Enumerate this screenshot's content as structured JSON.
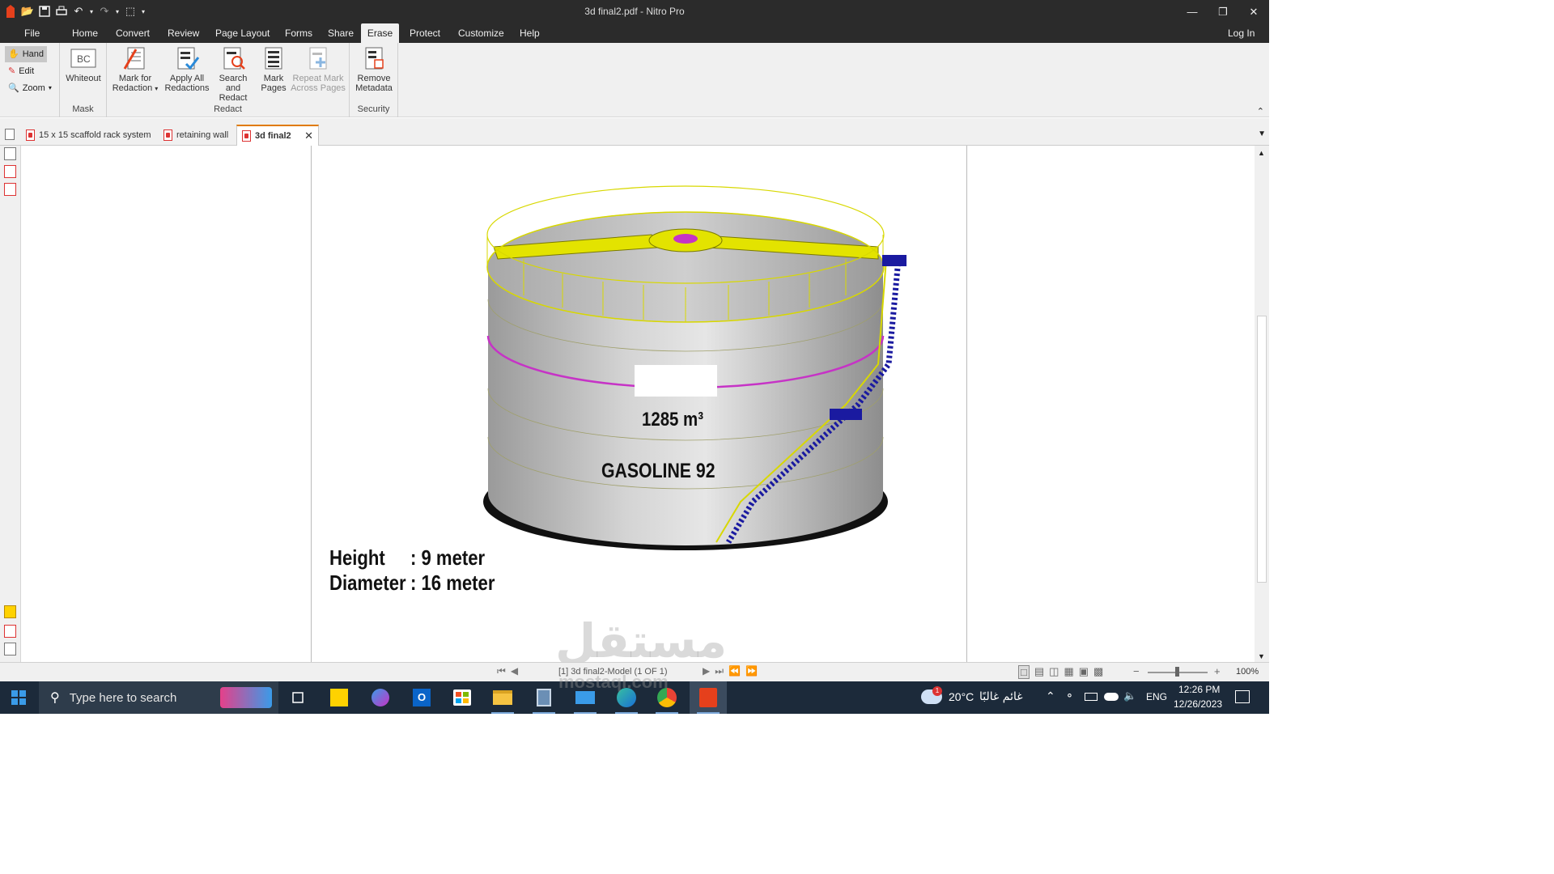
{
  "window": {
    "title": "3d final2.pdf - Nitro Pro",
    "login": "Log In"
  },
  "menu": [
    "File",
    "Home",
    "Convert",
    "Review",
    "Page Layout",
    "Forms",
    "Share",
    "Erase",
    "Protect",
    "Customize",
    "Help"
  ],
  "active_menu": "Erase",
  "ribbon": {
    "tools": {
      "hand": "Hand",
      "edit": "Edit",
      "zoom": "Zoom"
    },
    "mask": {
      "label": "Mask",
      "whiteout": "Whiteout"
    },
    "redact": {
      "label": "Redact",
      "mark1": "Mark for",
      "mark2": "Redaction",
      "apply1": "Apply All",
      "apply2": "Redactions",
      "search1": "Search and",
      "search2": "Redact",
      "pages1": "Mark",
      "pages2": "Pages",
      "repeat1": "Repeat Mark",
      "repeat2": "Across Pages"
    },
    "security": {
      "label": "Security",
      "remove1": "Remove",
      "remove2": "Metadata"
    }
  },
  "doc_tabs": [
    {
      "label": "15 x 15 scaffold rack system"
    },
    {
      "label": "retaining wall"
    },
    {
      "label": "3d final2"
    }
  ],
  "document": {
    "capacity": "1285 m³",
    "product": "GASOLINE 92",
    "height_label": "Height",
    "height_value": ": 9 meter",
    "diameter_label": "Diameter",
    "diameter_value": ": 16 meter",
    "watermark_ar": "مستقل",
    "watermark_url": "mostaql.com"
  },
  "status": {
    "page_info": "[1] 3d final2-Model (1 OF 1)",
    "zoom": "100%"
  },
  "taskbar": {
    "search_placeholder": "Type here to search",
    "weather_temp": "20°C",
    "weather_desc": "غائم غالبًا",
    "weather_badge": "1",
    "lang": "ENG",
    "time": "12:26 PM",
    "date": "12/26/2023"
  },
  "colors": {
    "accent": "#e07b00",
    "titlebar": "#2b2b2b",
    "ribbon": "#f0f0f0",
    "taskbar": "#1c2a3a"
  }
}
